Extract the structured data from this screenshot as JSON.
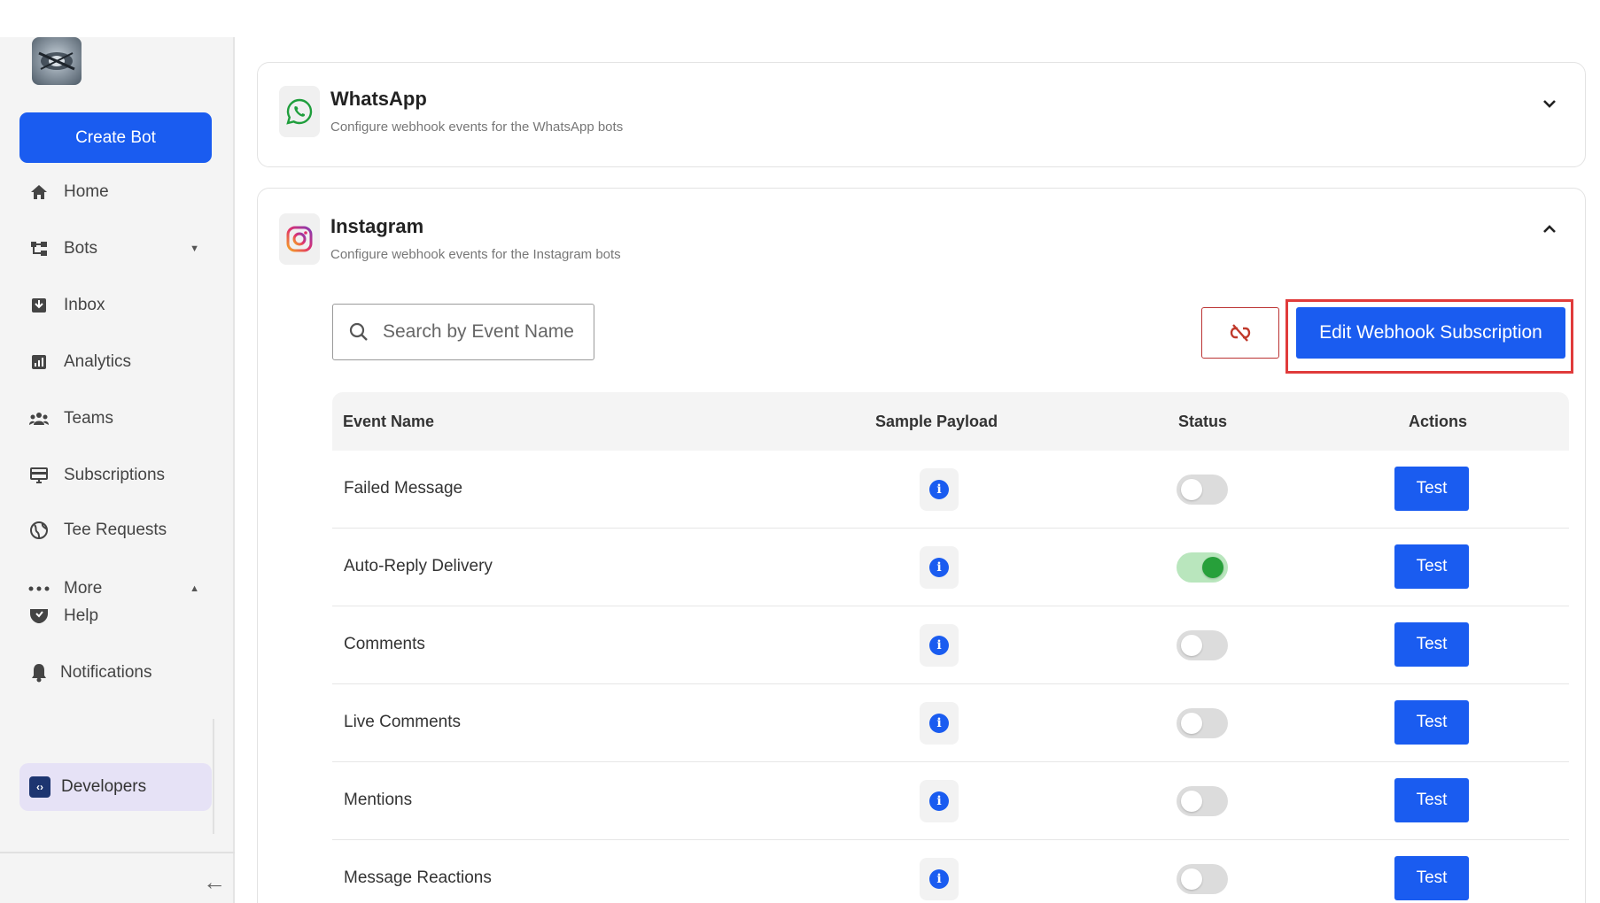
{
  "sidebar": {
    "create_bot": "Create Bot",
    "items": [
      {
        "label": "Home",
        "icon": "home-icon"
      },
      {
        "label": "Bots",
        "icon": "bots-icon"
      },
      {
        "label": "Inbox",
        "icon": "inbox-icon"
      },
      {
        "label": "Analytics",
        "icon": "analytics-icon"
      },
      {
        "label": "Teams",
        "icon": "teams-icon"
      },
      {
        "label": "Subscriptions",
        "icon": "subscriptions-icon"
      },
      {
        "label": "Tee Requests",
        "icon": "globe-icon"
      },
      {
        "label": "More",
        "icon": "more-icon"
      },
      {
        "label": "Help",
        "icon": "help-icon"
      },
      {
        "label": "Notifications",
        "icon": "bell-icon"
      }
    ],
    "active": {
      "label": "Developers",
      "icon": "developers-icon"
    }
  },
  "main": {
    "whatsapp": {
      "title": "WhatsApp",
      "subtitle": "Configure webhook events for the WhatsApp bots"
    },
    "instagram": {
      "title": "Instagram",
      "subtitle": "Configure webhook events for the Instagram bots",
      "search_placeholder": "Search by Event Name",
      "edit_button": "Edit Webhook Subscription",
      "table": {
        "headers": [
          "Event Name",
          "Sample Payload",
          "Status",
          "Actions"
        ],
        "rows": [
          {
            "name": "Failed Message",
            "enabled": false,
            "action": "Test"
          },
          {
            "name": "Auto-Reply Delivery",
            "enabled": true,
            "action": "Test"
          },
          {
            "name": "Comments",
            "enabled": false,
            "action": "Test"
          },
          {
            "name": "Live Comments",
            "enabled": false,
            "action": "Test"
          },
          {
            "name": "Mentions",
            "enabled": false,
            "action": "Test"
          },
          {
            "name": "Message Reactions",
            "enabled": false,
            "action": "Test"
          }
        ]
      }
    }
  },
  "colors": {
    "accent": "#1a5cf0",
    "highlight": "#e03b3b",
    "toggle_on": "#27a03a"
  }
}
